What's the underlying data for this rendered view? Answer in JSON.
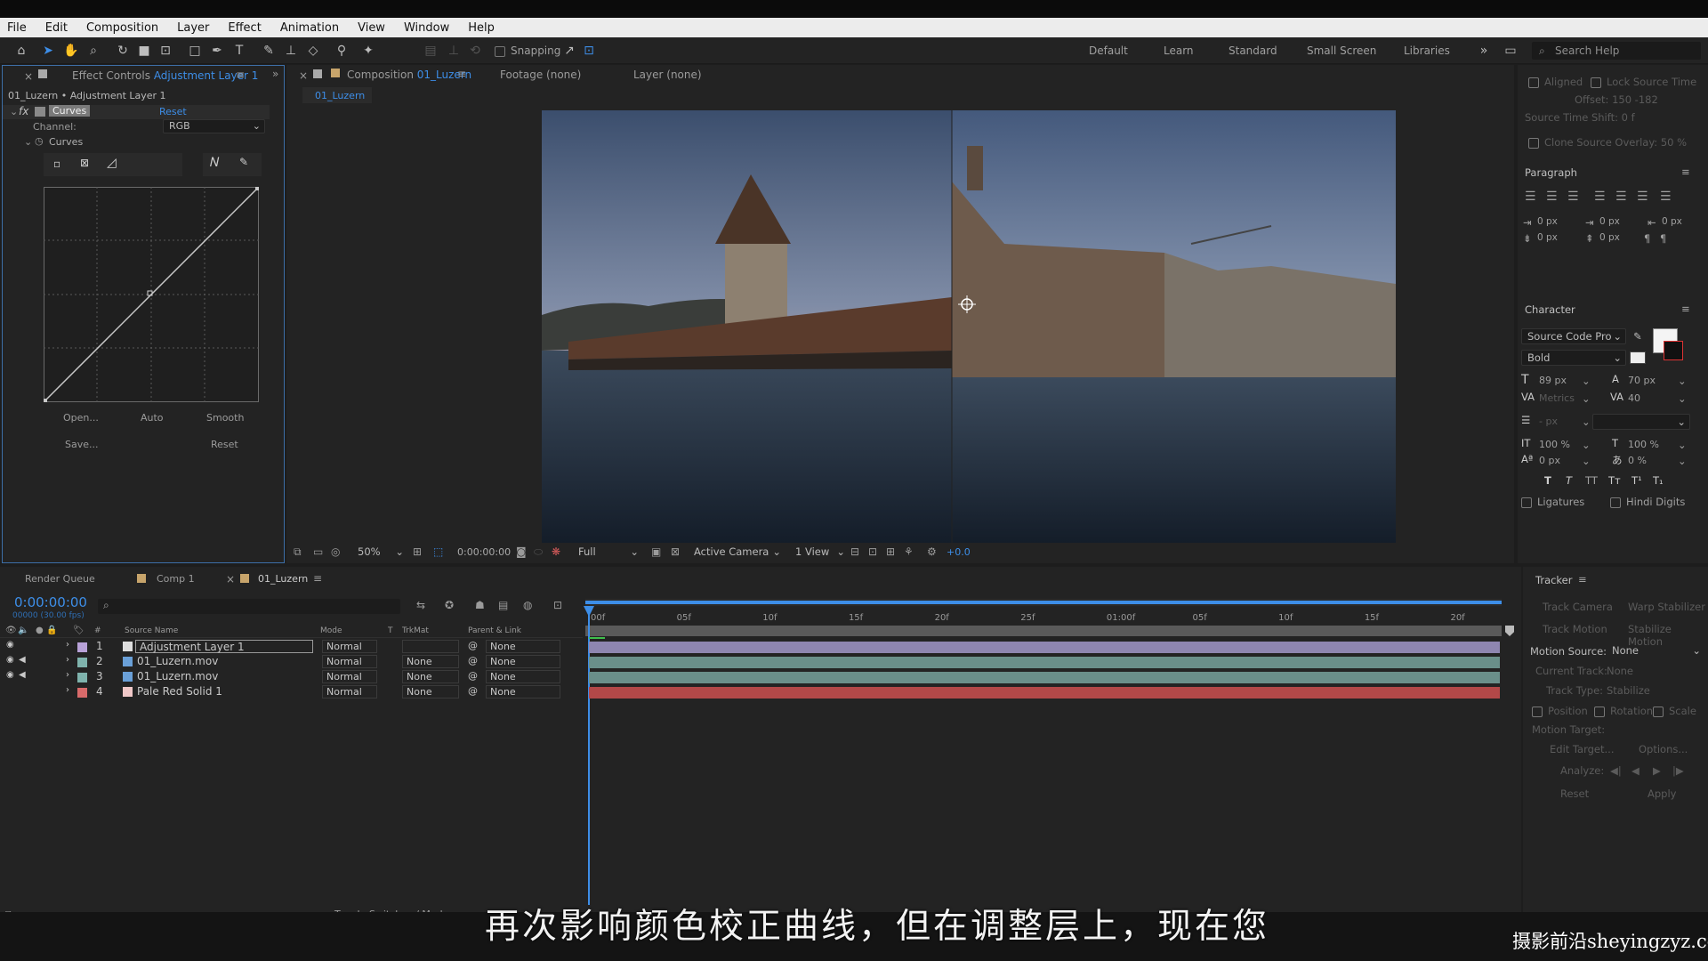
{
  "menu": [
    "File",
    "Edit",
    "Composition",
    "Layer",
    "Effect",
    "Animation",
    "View",
    "Window",
    "Help"
  ],
  "toolbar": {
    "snapping_label": "Snapping",
    "workspaces": [
      "Default",
      "Learn",
      "Standard",
      "Small Screen",
      "Libraries"
    ],
    "search_placeholder": "Search Help"
  },
  "effect_controls": {
    "tab_prefix": "Effect Controls",
    "tab_layer": "Adjustment Layer 1",
    "breadcrumb": "01_Luzern • Adjustment Layer 1",
    "effect_name": "Curves",
    "reset": "Reset",
    "channel_label": "Channel:",
    "channel_value": "RGB",
    "curves_label": "Curves",
    "buttons": {
      "open": "Open...",
      "auto": "Auto",
      "smooth": "Smooth",
      "save": "Save...",
      "reset": "Reset"
    }
  },
  "composition": {
    "tab_prefix": "Composition",
    "tab_name": "01_Luzern",
    "footage_tab": "Footage (none)",
    "layer_tab": "Layer (none)",
    "breadcrumb": "01_Luzern",
    "zoom": "50%",
    "timecode": "0:00:00:00",
    "resolution": "Full",
    "camera": "Active Camera",
    "views": "1 View",
    "exposure": "+0.0"
  },
  "right_panel": {
    "top_rows": [
      "Aligned",
      "Lock Source Time",
      "Offset: 150   -182",
      "Source Time Shift: 0 f",
      "Clone Source Overlay: 50 %"
    ],
    "paragraph_title": "Paragraph",
    "paragraph_values": [
      "0 px",
      "0 px",
      "0 px",
      "0 px",
      "0 px"
    ],
    "character_title": "Character",
    "font_family": "Source Code Pro",
    "font_style": "Bold",
    "font_size": "89 px",
    "leading": "70 px",
    "kerning": "Metrics",
    "tracking": "40",
    "stroke": "- px",
    "vscale": "100 %",
    "hscale": "100 %",
    "baseline": "0 px",
    "tsume": "0 %",
    "ligatures": "Ligatures",
    "hindi_digits": "Hindi Digits"
  },
  "timeline": {
    "tabs": [
      "Render Queue",
      "Comp 1",
      "01_Luzern"
    ],
    "timecode": "0:00:00:00",
    "fps": "00000 (30.00 fps)",
    "columns": {
      "source_name": "Source Name",
      "mode": "Mode",
      "t": "T",
      "trkmat": "TrkMat",
      "parent": "Parent & Link"
    },
    "ruler": [
      "00f",
      "05f",
      "10f",
      "15f",
      "20f",
      "25f",
      "01:00f",
      "05f",
      "10f",
      "15f",
      "20f"
    ],
    "layers": [
      {
        "num": "1",
        "name": "Adjustment Layer 1",
        "mode": "Normal",
        "trkmat": "",
        "parent": "None",
        "label_color": "#b8a2d8",
        "bar_color": "#8e86b0"
      },
      {
        "num": "2",
        "name": "01_Luzern.mov",
        "mode": "Normal",
        "trkmat": "None",
        "parent": "None",
        "label_color": "#7fb3ad",
        "bar_color": "#6a8f8a"
      },
      {
        "num": "3",
        "name": "01_Luzern.mov",
        "mode": "Normal",
        "trkmat": "None",
        "parent": "None",
        "label_color": "#7fb3ad",
        "bar_color": "#6a8f8a"
      },
      {
        "num": "4",
        "name": "Pale Red Solid 1",
        "mode": "Normal",
        "trkmat": "None",
        "parent": "None",
        "label_color": "#d86a6a",
        "bar_color": "#b24848"
      }
    ],
    "toggle_label": "Toggle Switches / Modes"
  },
  "tracker": {
    "title": "Tracker",
    "track_camera": "Track Camera",
    "warp_stabilizer": "Warp Stabilizer",
    "track_motion": "Track Motion",
    "stabilize_motion": "Stabilize Motion",
    "motion_source_label": "Motion Source:",
    "motion_source_value": "None",
    "current_track_label": "Current Track:",
    "current_track_value": "None",
    "track_type_label": "Track Type:",
    "track_type_value": "Stabilize",
    "position": "Position",
    "rotation": "Rotation",
    "scale": "Scale",
    "motion_target": "Motion Target:",
    "edit_target": "Edit Target...",
    "options": "Options...",
    "analyze": "Analyze:",
    "reset": "Reset",
    "apply": "Apply"
  },
  "subtitle": "再次影响颜色校正曲线，但在调整层上，现在您",
  "watermark": "摄影前沿sheyingzyz.com"
}
